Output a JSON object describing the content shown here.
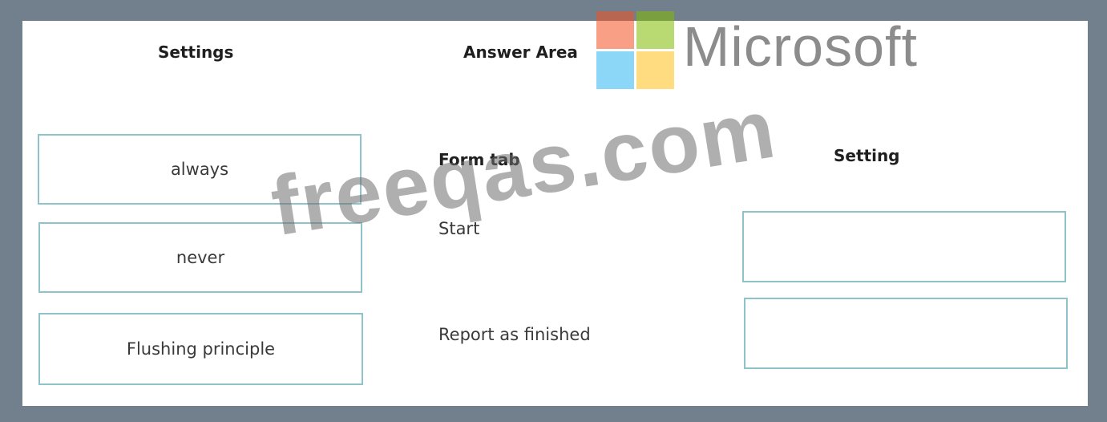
{
  "headings": {
    "settings": "Settings",
    "answer_area": "Answer Area",
    "form_tab": "Form tab",
    "setting": "Setting"
  },
  "options": [
    {
      "label": "always"
    },
    {
      "label": "never"
    },
    {
      "label": "Flushing principle"
    }
  ],
  "rows": [
    {
      "label": "Start",
      "value": ""
    },
    {
      "label": "Report as finished",
      "value": ""
    }
  ],
  "logo": {
    "text": "Microsoft",
    "colors": [
      "#f25022",
      "#7fba00",
      "#00a4ef",
      "#ffb900"
    ]
  },
  "watermark": "freeqas.com",
  "colors": {
    "frame": "#727f8c",
    "box_border": "#8ec3ca"
  }
}
